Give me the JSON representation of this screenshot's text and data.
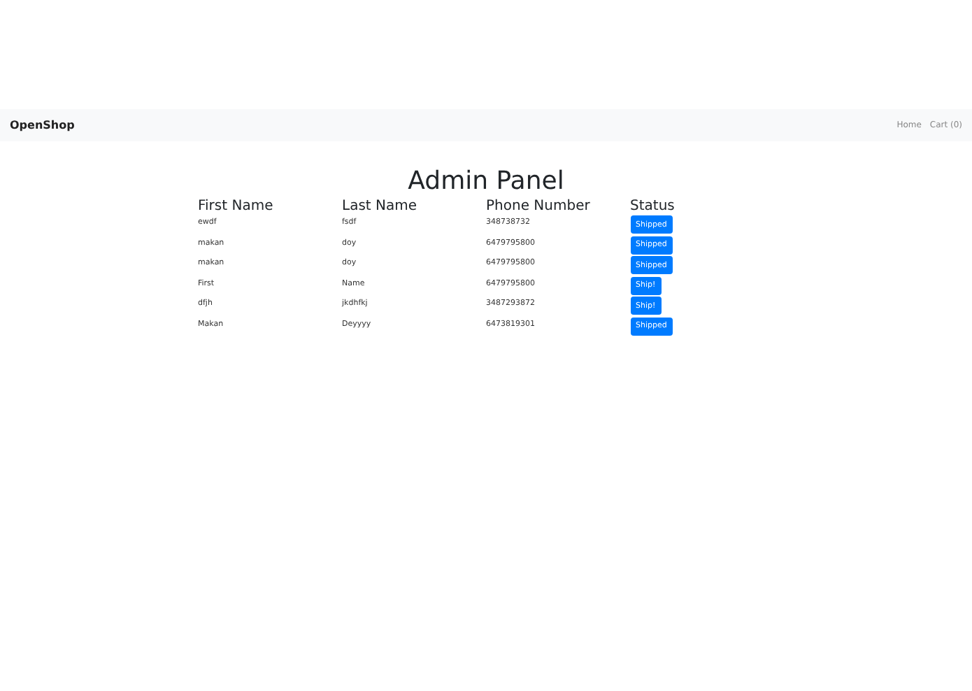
{
  "navbar": {
    "brand": "OpenShop",
    "links": [
      "Home",
      "Cart (0)"
    ]
  },
  "title": "Admin Panel",
  "table": {
    "columns": [
      "First Name",
      "Last Name",
      "Phone Number",
      "Status"
    ],
    "rows": [
      {
        "first": "ewdf",
        "last": "fsdf",
        "phone": "348738732",
        "status": "Shipped"
      },
      {
        "first": "makan",
        "last": "doy",
        "phone": "6479795800",
        "status": "Shipped"
      },
      {
        "first": "makan",
        "last": "doy",
        "phone": "6479795800",
        "status": "Shipped"
      },
      {
        "first": "First",
        "last": "Name",
        "phone": "6479795800",
        "status": "Ship!"
      },
      {
        "first": "dfjh",
        "last": "jkdhfkj",
        "phone": "3487293872",
        "status": "Ship!"
      },
      {
        "first": "Makan",
        "last": "Deyyyy",
        "phone": "6473819301",
        "status": "Shipped"
      }
    ]
  }
}
